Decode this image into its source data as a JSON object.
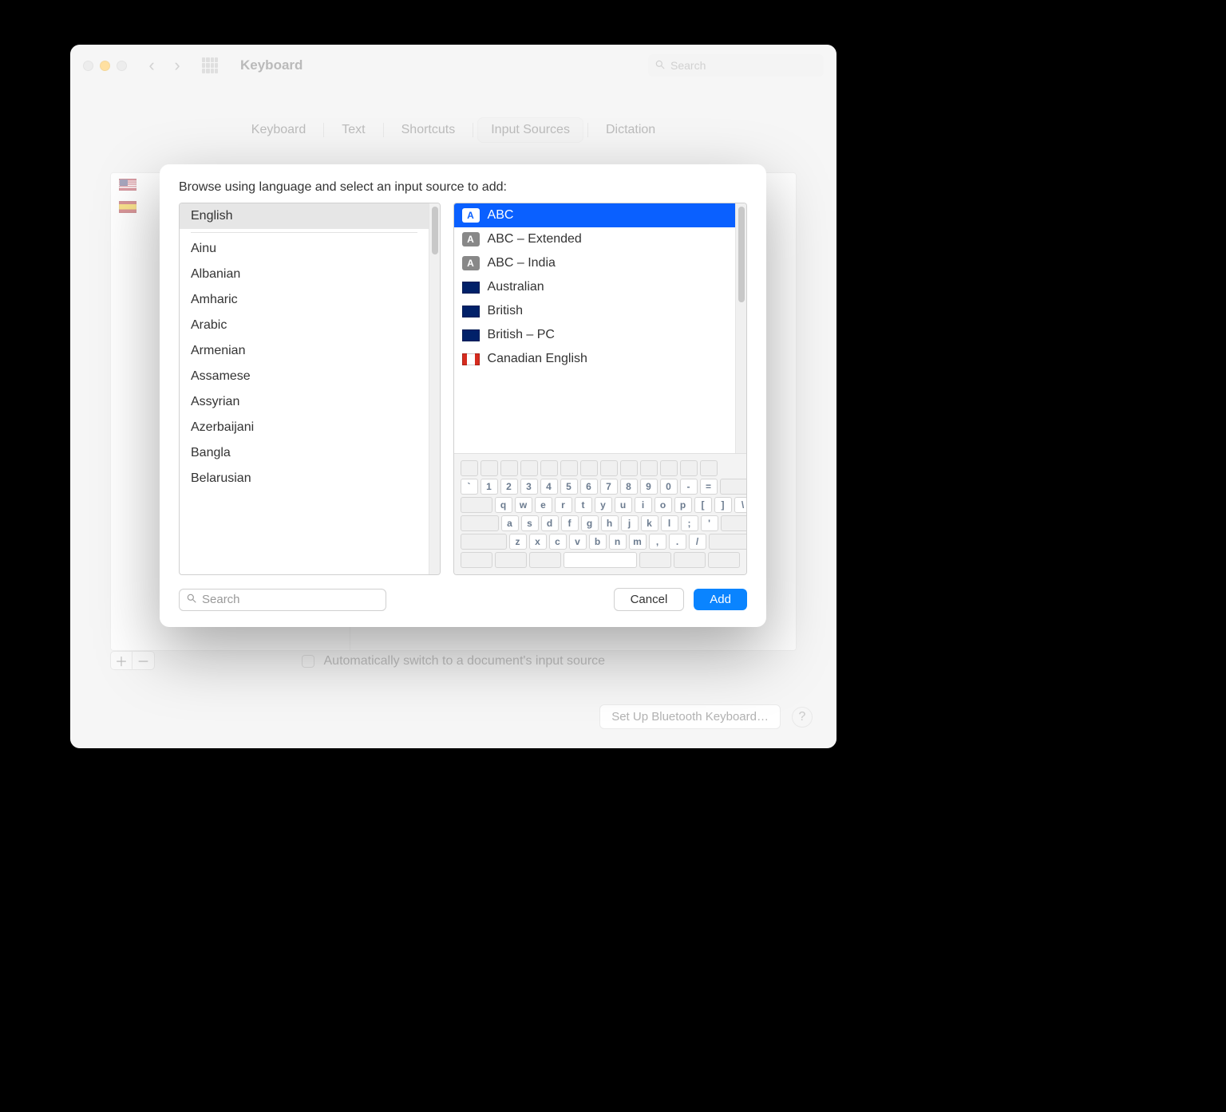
{
  "window": {
    "title": "Keyboard",
    "search_placeholder": "Search"
  },
  "tabs": [
    {
      "label": "Keyboard",
      "selected": false
    },
    {
      "label": "Text",
      "selected": false
    },
    {
      "label": "Shortcuts",
      "selected": false
    },
    {
      "label": "Input Sources",
      "selected": true
    },
    {
      "label": "Dictation",
      "selected": false
    }
  ],
  "auto_switch_label": "Automatically switch to a document's input source",
  "bluetooth_button": "Set Up Bluetooth Keyboard…",
  "modal": {
    "title": "Browse using language and select an input source to add:",
    "search_placeholder": "Search",
    "cancel_label": "Cancel",
    "add_label": "Add",
    "languages": [
      "English",
      "Ainu",
      "Albanian",
      "Amharic",
      "Arabic",
      "Armenian",
      "Assamese",
      "Assyrian",
      "Azerbaijani",
      "Bangla",
      "Belarusian"
    ],
    "selected_language_index": 0,
    "sources": [
      {
        "icon": "a-blue",
        "label": "ABC",
        "selected": true
      },
      {
        "icon": "a-gray",
        "label": "ABC – Extended"
      },
      {
        "icon": "a-gray",
        "label": "ABC – India"
      },
      {
        "icon": "flag-au",
        "label": "Australian"
      },
      {
        "icon": "flag-uk",
        "label": "British"
      },
      {
        "icon": "flag-uk",
        "label": "British – PC"
      },
      {
        "icon": "flag-ca",
        "label": "Canadian English"
      }
    ],
    "keyboard_rows": [
      [
        "`",
        "1",
        "2",
        "3",
        "4",
        "5",
        "6",
        "7",
        "8",
        "9",
        "0",
        "-",
        "="
      ],
      [
        "q",
        "w",
        "e",
        "r",
        "t",
        "y",
        "u",
        "i",
        "o",
        "p",
        "[",
        "]",
        "\\"
      ],
      [
        "a",
        "s",
        "d",
        "f",
        "g",
        "h",
        "j",
        "k",
        "l",
        ";",
        "'"
      ],
      [
        "z",
        "x",
        "c",
        "v",
        "b",
        "n",
        "m",
        ",",
        ".",
        "/"
      ]
    ]
  }
}
